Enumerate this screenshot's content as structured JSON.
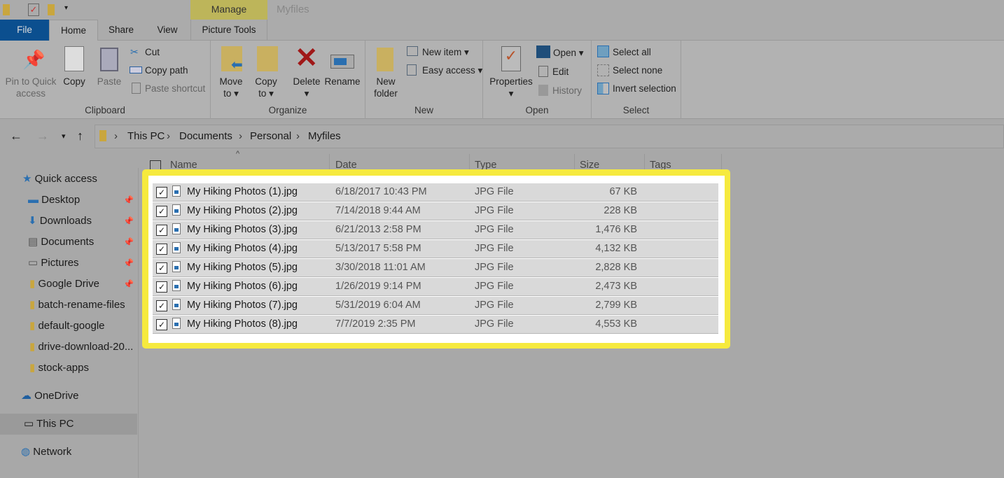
{
  "window": {
    "title": "Myfiles",
    "context_tab": "Manage",
    "context_group": "Picture Tools"
  },
  "tabs": [
    "File",
    "Home",
    "Share",
    "View"
  ],
  "ribbon": {
    "clipboard": {
      "label": "Clipboard",
      "pin": "Pin to Quick access",
      "copy": "Copy",
      "paste": "Paste",
      "cut": "Cut",
      "copy_path": "Copy path",
      "paste_shortcut": "Paste shortcut"
    },
    "organize": {
      "label": "Organize",
      "move_to": "Move to",
      "copy_to": "Copy to",
      "delete": "Delete",
      "rename": "Rename"
    },
    "new": {
      "label": "New",
      "new_folder": "New folder",
      "new_item": "New item",
      "easy_access": "Easy access"
    },
    "open": {
      "label": "Open",
      "properties": "Properties",
      "open": "Open",
      "edit": "Edit",
      "history": "History"
    },
    "select": {
      "label": "Select",
      "select_all": "Select all",
      "select_none": "Select none",
      "invert": "Invert selection"
    }
  },
  "breadcrumb": [
    "This PC",
    "Documents",
    "Personal",
    "Myfiles"
  ],
  "sidebar": {
    "quick_access": "Quick access",
    "items": [
      "Desktop",
      "Downloads",
      "Documents",
      "Pictures",
      "Google Drive",
      "batch-rename-files",
      "default-google",
      "drive-download-20...",
      "stock-apps"
    ],
    "onedrive": "OneDrive",
    "this_pc": "This PC",
    "network": "Network"
  },
  "columns": {
    "name": "Name",
    "date": "Date",
    "type": "Type",
    "size": "Size",
    "tags": "Tags"
  },
  "files": [
    {
      "name": "My Hiking Photos (1).jpg",
      "date": "6/18/2017 10:43 PM",
      "type": "JPG File",
      "size": "67 KB"
    },
    {
      "name": "My Hiking Photos (2).jpg",
      "date": "7/14/2018 9:44 AM",
      "type": "JPG File",
      "size": "228 KB"
    },
    {
      "name": "My Hiking Photos (3).jpg",
      "date": "6/21/2013 2:58 PM",
      "type": "JPG File",
      "size": "1,476 KB"
    },
    {
      "name": "My Hiking Photos (4).jpg",
      "date": "5/13/2017 5:58 PM",
      "type": "JPG File",
      "size": "4,132 KB"
    },
    {
      "name": "My Hiking Photos (5).jpg",
      "date": "3/30/2018 11:01 AM",
      "type": "JPG File",
      "size": "2,828 KB"
    },
    {
      "name": "My Hiking Photos (6).jpg",
      "date": "1/26/2019 9:14 PM",
      "type": "JPG File",
      "size": "2,473 KB"
    },
    {
      "name": "My Hiking Photos (7).jpg",
      "date": "5/31/2019 6:04 AM",
      "type": "JPG File",
      "size": "2,799 KB"
    },
    {
      "name": "My Hiking Photos (8).jpg",
      "date": "7/7/2019 2:35 PM",
      "type": "JPG File",
      "size": "4,553 KB"
    }
  ],
  "colors": {
    "highlight": "#f6ea3e",
    "file_tab": "#0b4f8f",
    "manage_tab": "#bdb55a"
  }
}
